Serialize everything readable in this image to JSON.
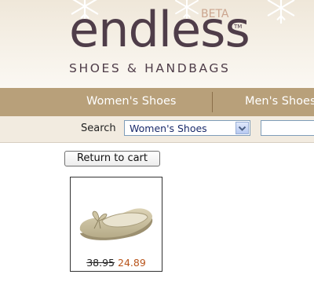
{
  "brand": {
    "name": "endless",
    "badge": "BETA",
    "trademark": "TM",
    "tagline": "SHOES & HANDBAGS"
  },
  "nav": {
    "items": [
      {
        "label": "Women's Shoes"
      },
      {
        "label": "Men's Shoes"
      }
    ]
  },
  "search": {
    "label": "Search",
    "selected_category": "Women's Shoes",
    "query_value": ""
  },
  "cart": {
    "return_label": "Return to cart"
  },
  "product": {
    "original_price": "38.95",
    "sale_price": "24.89"
  },
  "colors": {
    "brand_text": "#4f3d49",
    "nav_bg": "#b8a07a",
    "sale_price": "#b8541a"
  }
}
